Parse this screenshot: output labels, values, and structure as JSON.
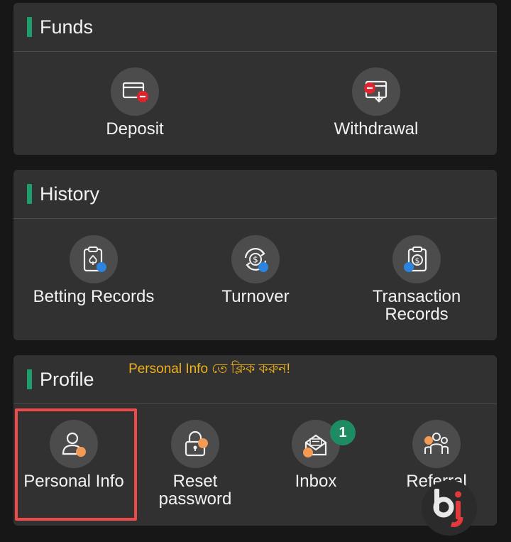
{
  "funds": {
    "title": "Funds",
    "items": [
      {
        "label": "Deposit",
        "icon": "deposit-card-icon"
      },
      {
        "label": "Withdrawal",
        "icon": "withdrawal-card-icon"
      }
    ]
  },
  "history": {
    "title": "History",
    "items": [
      {
        "label": "Betting Records",
        "icon": "betting-clipboard-icon"
      },
      {
        "label": "Turnover",
        "icon": "turnover-dollar-icon"
      },
      {
        "label": "Transaction\nRecords",
        "icon": "transaction-clipboard-icon"
      }
    ]
  },
  "profile": {
    "title": "Profile",
    "annotation": "Personal Info তে ক্লিক করুন!",
    "items": [
      {
        "label": "Personal Info",
        "icon": "person-icon"
      },
      {
        "label": "Reset\npassword",
        "icon": "padlock-icon"
      },
      {
        "label": "Inbox",
        "icon": "envelope-icon",
        "badge": "1"
      },
      {
        "label": "Referral",
        "icon": "group-icon"
      }
    ]
  },
  "colors": {
    "accent": "#1e9d6d",
    "card": "#313131",
    "highlight": "#ee4a4a",
    "annotation": "#f0b21a",
    "badge": "#1e8c63",
    "icon_red": "#e0232c",
    "icon_blue": "#2a84e0",
    "icon_orange": "#f39a55"
  },
  "watermark": {
    "text": "bj"
  }
}
